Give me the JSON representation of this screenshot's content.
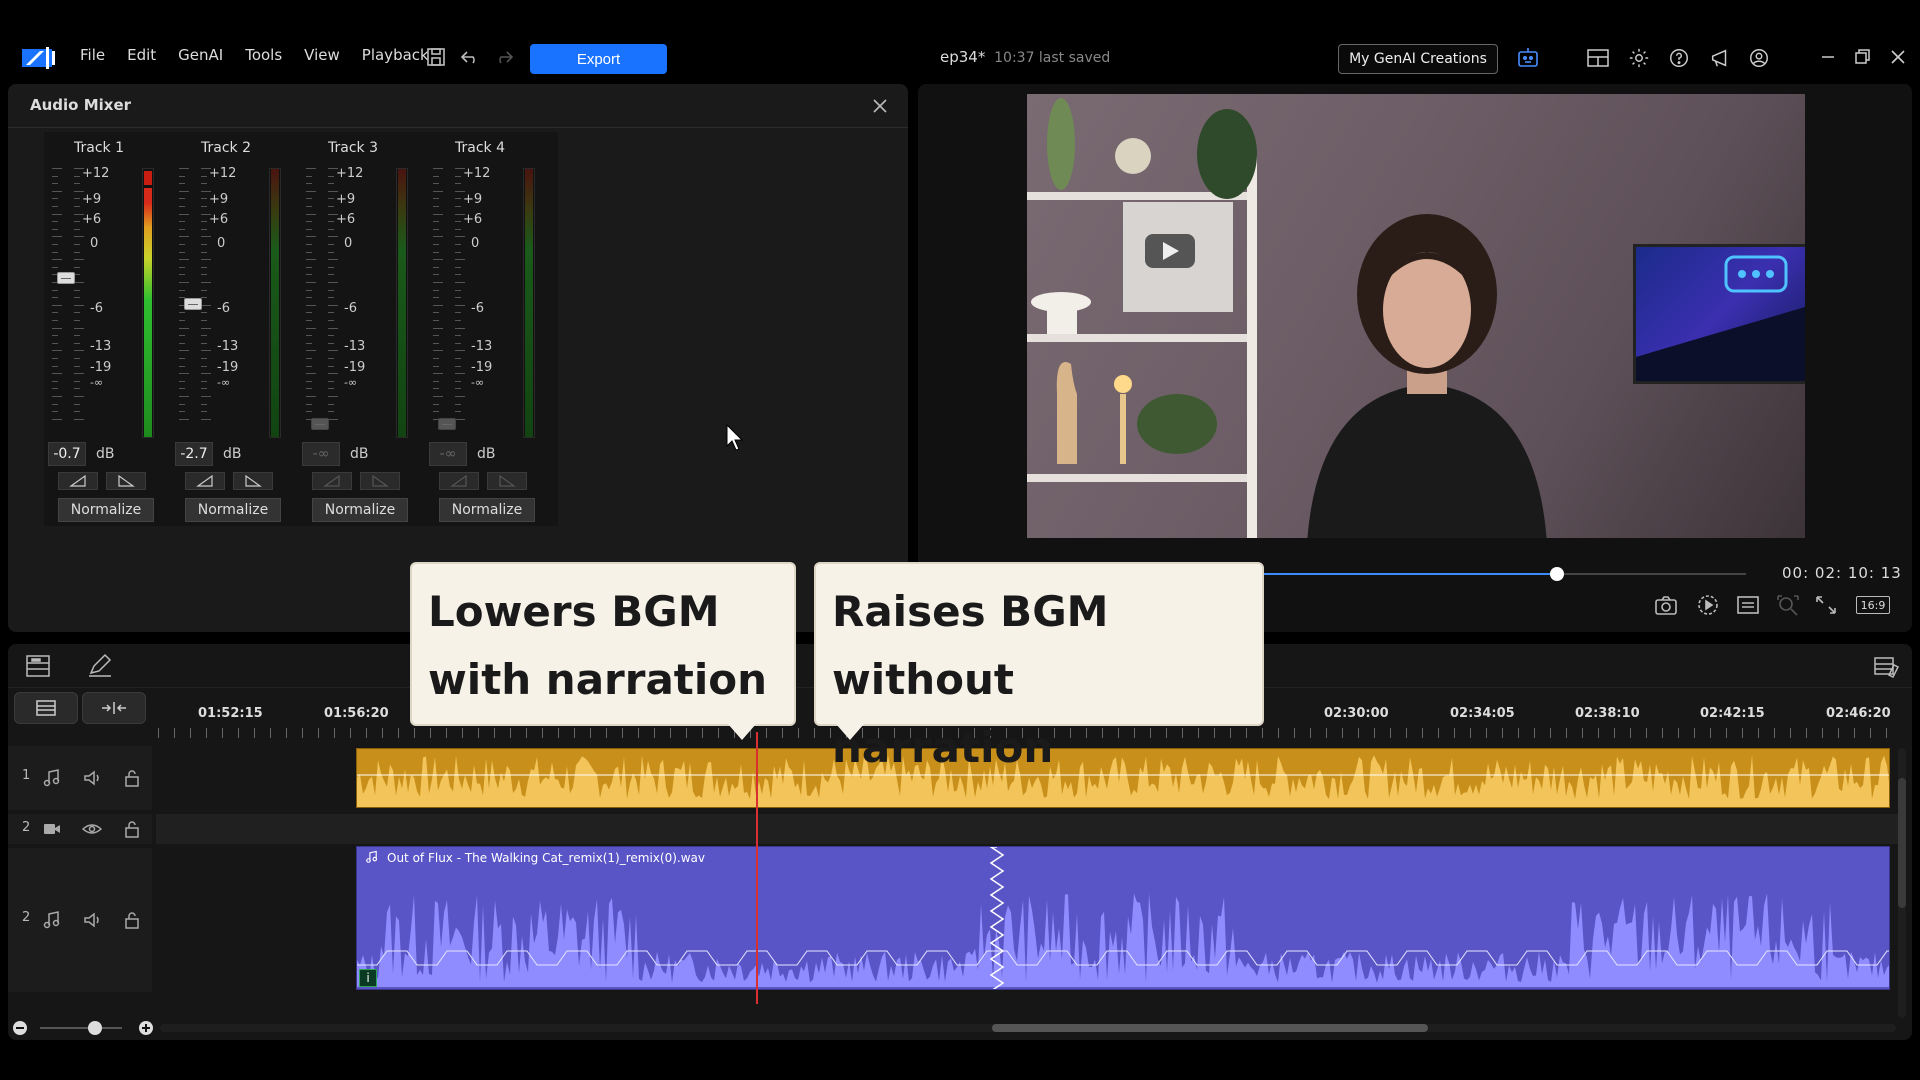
{
  "menu": {
    "items": [
      "File",
      "Edit",
      "GenAI",
      "Tools",
      "View",
      "Playback"
    ]
  },
  "toolbar": {
    "export_label": "Export",
    "icons": [
      "save-icon",
      "undo-icon",
      "redo-icon"
    ]
  },
  "project": {
    "name": "ep34*",
    "saved_status": "10:37 last saved"
  },
  "header_right": {
    "genai_button": "My GenAI Creations",
    "icons": [
      "genai-assistant-icon",
      "layout-icon",
      "gear-icon",
      "help-icon",
      "announcement-icon",
      "account-icon",
      "minimize-icon",
      "restore-icon",
      "close-icon"
    ]
  },
  "mixer": {
    "title": "Audio Mixer",
    "scale_labels": [
      "+12",
      "+9",
      "+6",
      "0",
      "-6",
      "-13",
      "-19",
      "-∞"
    ],
    "db_unit": "dB",
    "normalize_label": "Normalize",
    "tracks": [
      {
        "label": "Track 1",
        "db": "-0.7",
        "active": true,
        "fader_level": 0.58,
        "meter_level": 0.93
      },
      {
        "label": "Track 2",
        "db": "-2.7",
        "active": true,
        "fader_level": 0.48,
        "meter_level": 0.0
      },
      {
        "label": "Track 3",
        "db": "-∞",
        "active": false,
        "fader_level": 0.0,
        "meter_level": 0.0
      },
      {
        "label": "Track 4",
        "db": "-∞",
        "active": false,
        "fader_level": 0.0,
        "meter_level": 0.0
      }
    ]
  },
  "preview": {
    "timecode": "00: 02: 10: 13",
    "progress": 0.61,
    "aspect_ratio": "16:9",
    "icons": [
      "snapshot-icon",
      "play-mode-icon",
      "subtitles-icon",
      "zoom-icon",
      "fullscreen-icon"
    ]
  },
  "callouts": {
    "left": {
      "line1": "Lowers BGM",
      "line2": "with narration"
    },
    "right": {
      "line1": "Raises BGM",
      "line2": "without narration"
    }
  },
  "timeline": {
    "ruler": [
      "01:52:15",
      "01:56:20",
      "02:30:00",
      "02:34:05",
      "02:38:10",
      "02:42:15",
      "02:46:20"
    ],
    "tracks": [
      {
        "number": "1",
        "type": "audio"
      },
      {
        "number": "2",
        "type": "video"
      },
      {
        "number": "2",
        "type": "audio"
      }
    ],
    "clip_name": "Out of Flux - The Walking Cat_remix(1)_remix(0).wav"
  },
  "colors": {
    "accent": "#1a73ff",
    "audio_clip_1": "#c8901a",
    "audio_clip_2": "#5a55c6",
    "playhead": "#d83030"
  }
}
